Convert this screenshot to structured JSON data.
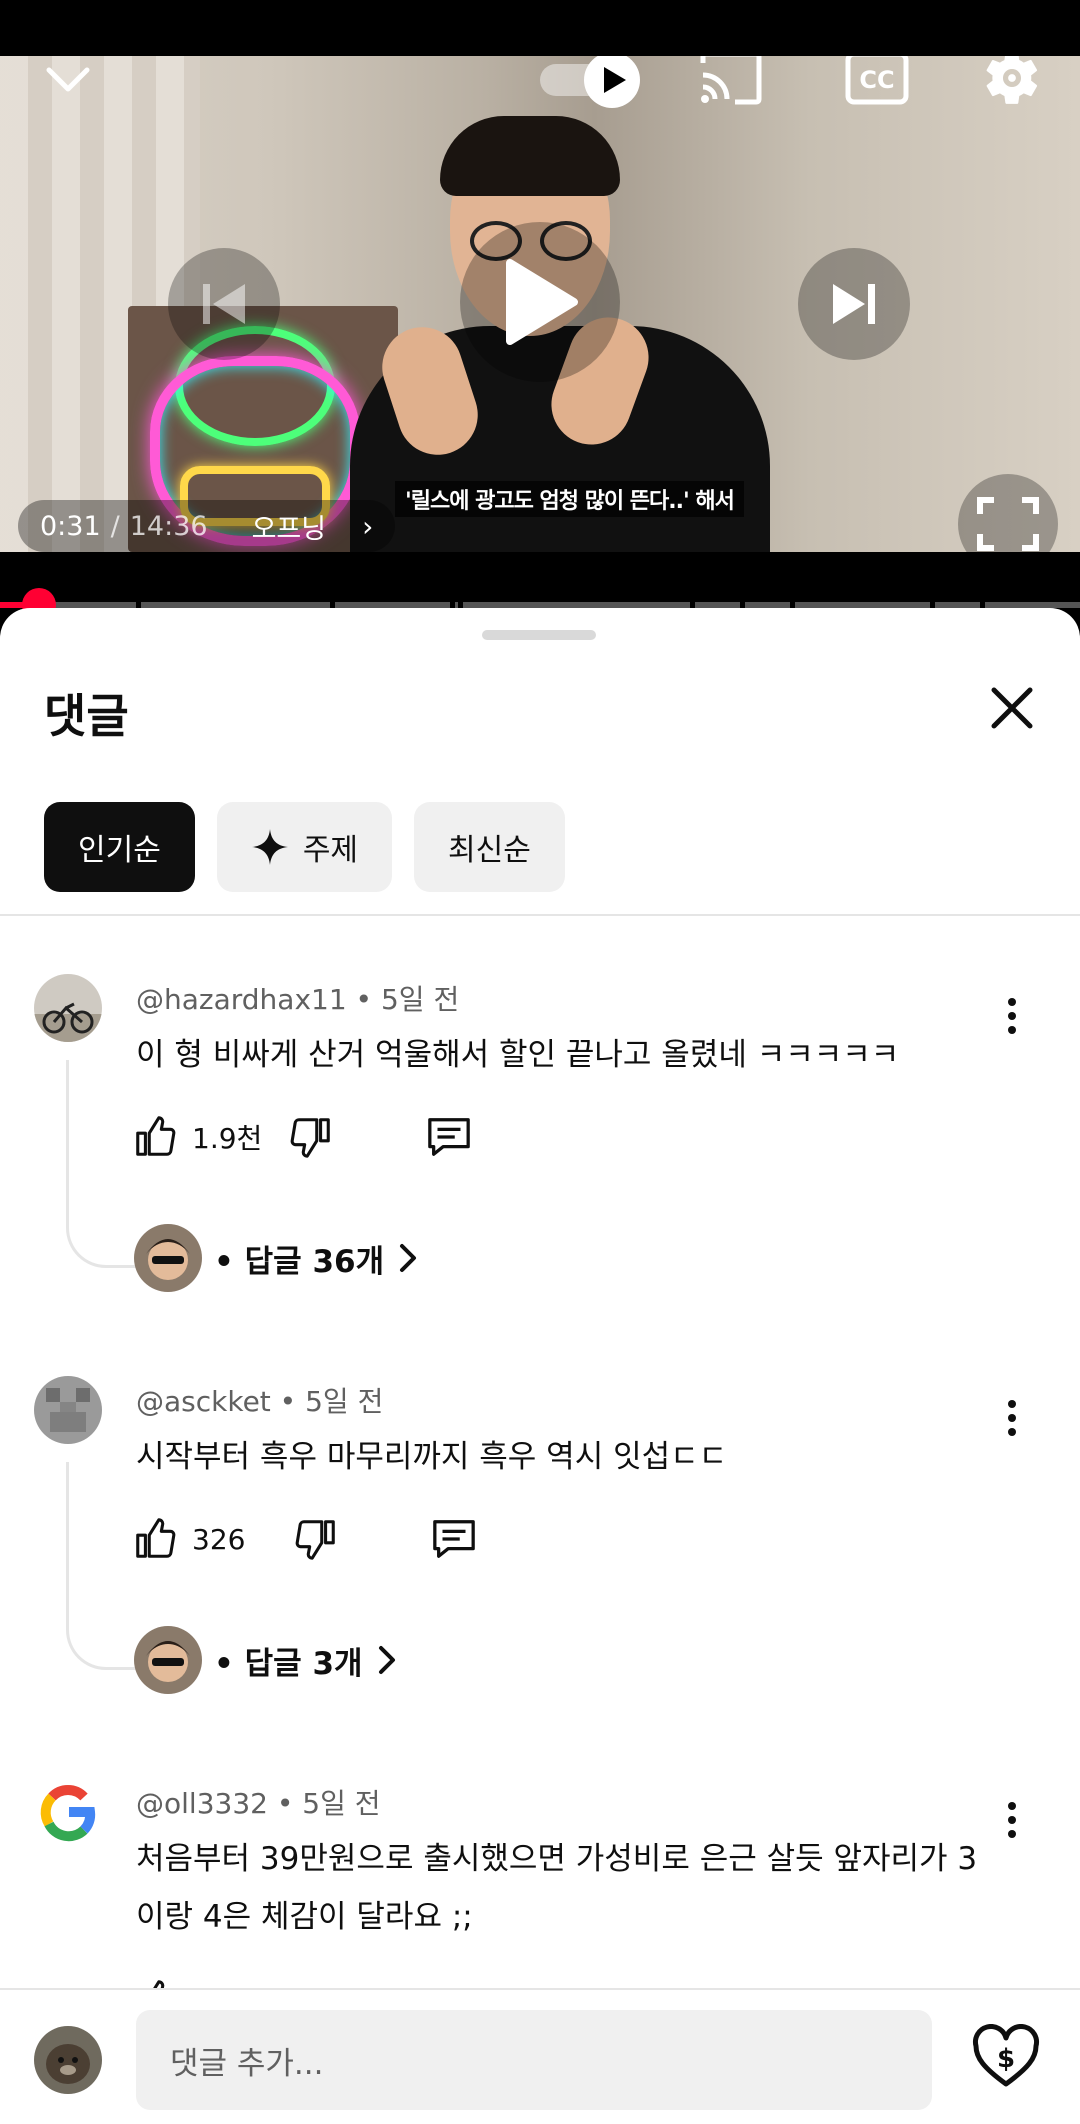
{
  "player": {
    "current_time": "0:31",
    "separator": "/",
    "duration": "14:36",
    "chapter": "오프닝",
    "subtitle_overlay": "'릴스에 광고도 엄청 많이 뜬다..' 해서",
    "state": "paused",
    "progress_fraction": 0.035
  },
  "sheet": {
    "title": "댓글",
    "chips": [
      {
        "label": "인기순",
        "active": true
      },
      {
        "label": "주제",
        "active": false,
        "icon": "sparkle-icon"
      },
      {
        "label": "최신순",
        "active": false
      }
    ]
  },
  "comments": [
    {
      "meta": "@hazardhax11 • 5일 전",
      "text": "이 형 비싸게 산거 억울해서 할인 끝나고 올렸네 ㅋㅋㅋㅋㅋ",
      "likes": "1.9천",
      "replies": "• 답글 36개"
    },
    {
      "meta": "@asckket • 5일 전",
      "text": "시작부터 흑우 마무리까지 흑우 역시 잇섭ㄷㄷ",
      "likes": "326",
      "replies": "• 답글 3개"
    },
    {
      "meta": "@oll3332 • 5일 전",
      "text": "처음부터 39만원으로 출시했으면 가성비로 은근 살듯 앞자리가 3이랑 4은 체감이 달라요 ;;"
    }
  ],
  "composer": {
    "placeholder": "댓글 추가..."
  },
  "colors": {
    "accent": "#ff0033",
    "chip_active_bg": "#0f0f0f",
    "chip_bg": "#f0f0f0"
  }
}
